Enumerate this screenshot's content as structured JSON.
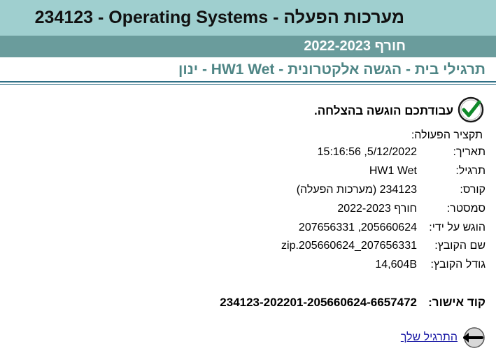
{
  "header": {
    "title": "234123 - Operating Systems - מערכות הפעלה",
    "semester": "חורף 2022-2023"
  },
  "assignment": {
    "title": "תרגילי בית - הגשה אלקטרונית - HW1 Wet - ינון"
  },
  "status": {
    "message": "עבודתכם הוגשה בהצלחה."
  },
  "summary": {
    "heading": "תקציר הפעולה:",
    "rows": [
      {
        "label": "תאריך:",
        "value": "15:16:56 ,5/12/2022"
      },
      {
        "label": "תרגיל:",
        "value": "HW1 Wet"
      },
      {
        "label": "קורס:",
        "value": "234123 (מערכות הפעלה)"
      },
      {
        "label": "סמסטר:",
        "value": "חורף 2022-2023"
      },
      {
        "label": "הוגש על ידי:",
        "value": "205660624, 207656331"
      },
      {
        "label": "שם הקובץ:",
        "value": "zip.205660624_207656331"
      },
      {
        "label": "גודל הקובץ:",
        "value": "14,604B"
      }
    ]
  },
  "approval": {
    "label": "קוד אישור:",
    "code": "234123-202201-205660624-6657472"
  },
  "navigation": {
    "next_label": "התרגיל שלך"
  },
  "colors": {
    "title_bg": "#9fcfcf",
    "subtitle_bg": "#6a9c9c",
    "hw_title": "#4e8585",
    "link": "#1a1aa6"
  },
  "icons": {
    "success": "check-circle-icon",
    "next": "arrow-left-circle-icon"
  }
}
